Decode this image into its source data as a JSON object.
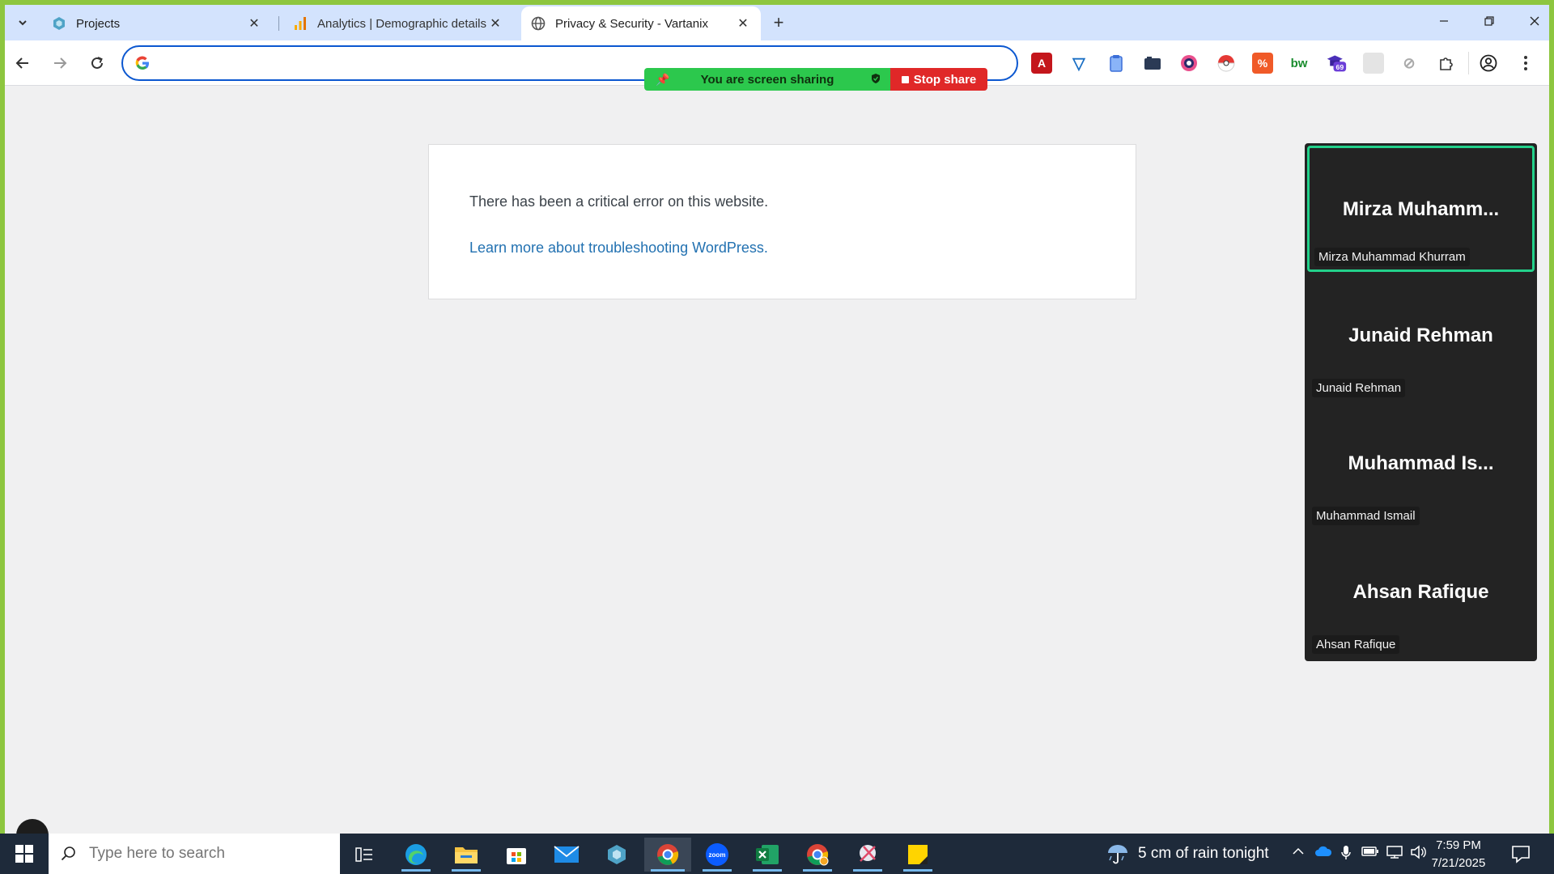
{
  "browser": {
    "tabs": [
      {
        "title": "Projects",
        "icon": "hexagon-app-icon"
      },
      {
        "title": "Analytics | Demographic details",
        "icon": "analytics-bars-icon"
      },
      {
        "title": "Privacy & Security - Vartanix",
        "icon": "globe-icon",
        "active": true
      }
    ],
    "new_tab": "+",
    "address": {
      "value": "",
      "placeholder": ""
    }
  },
  "extensions": [
    "acrobat-icon",
    "vpn-shield-icon",
    "clipboard-icon",
    "camera-icon",
    "color-picker-icon",
    "pokeball-icon",
    "percent-icon",
    "bw-icon",
    "grammar-hat-icon",
    "blank-extension-icon",
    "compass-icon",
    "puzzle-icon",
    "profile-icon",
    "menu-icon"
  ],
  "extension_badge": "69",
  "share": {
    "status": "You are screen sharing",
    "stop": "Stop share"
  },
  "page": {
    "error_message": "There has been a critical error on this website.",
    "link": "Learn more about troubleshooting WordPress."
  },
  "participants": [
    {
      "display": "Mirza  Muhamm...",
      "name": "Mirza Muhammad Khurram",
      "speaking": true
    },
    {
      "display": "Junaid Rehman",
      "name": "Junaid Rehman",
      "speaking": false
    },
    {
      "display": "Muhammad  Is...",
      "name": "Muhammad Ismail",
      "speaking": false
    },
    {
      "display": "Ahsan Rafique",
      "name": "Ahsan Rafique",
      "speaking": false
    }
  ],
  "taskbar": {
    "search_placeholder": "Type here to search",
    "weather": "5 cm of rain tonight",
    "time": "7:59 PM",
    "date": "7/21/2025"
  },
  "colors": {
    "accent_border": "#8dc63f",
    "share_green": "#2cc84d",
    "stop_red": "#e02828",
    "speaking_outline": "#23d18b",
    "link_blue": "#2271b1"
  }
}
